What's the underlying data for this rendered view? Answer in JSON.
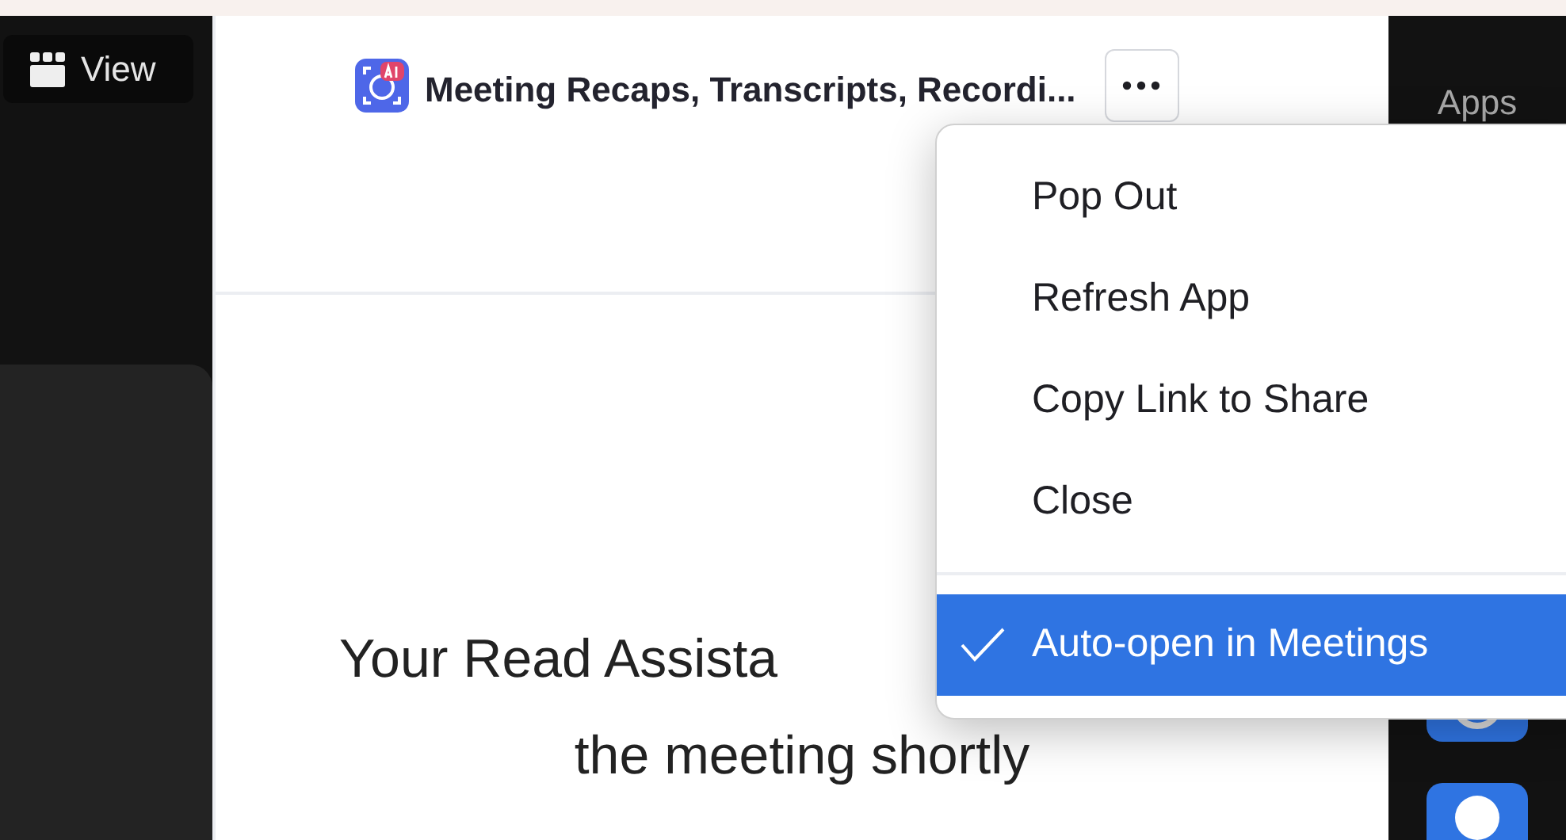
{
  "left_panel": {
    "view_button": "View"
  },
  "app_panel": {
    "title": "Meeting Recaps, Transcripts, Recordi...",
    "message_lines": [
      "Your Read Assista",
      "the meeting shortly"
    ]
  },
  "right_panel": {
    "label": "Apps"
  },
  "menu": {
    "groups": [
      [
        {
          "label": "Pop Out",
          "checked": false,
          "selected": false
        },
        {
          "label": "Refresh App",
          "checked": false,
          "selected": false
        },
        {
          "label": "Copy Link to Share",
          "checked": false,
          "selected": false
        },
        {
          "label": "Close",
          "checked": false,
          "selected": false
        }
      ],
      [
        {
          "label": "Auto-open in Meetings",
          "checked": true,
          "selected": true
        }
      ]
    ]
  }
}
